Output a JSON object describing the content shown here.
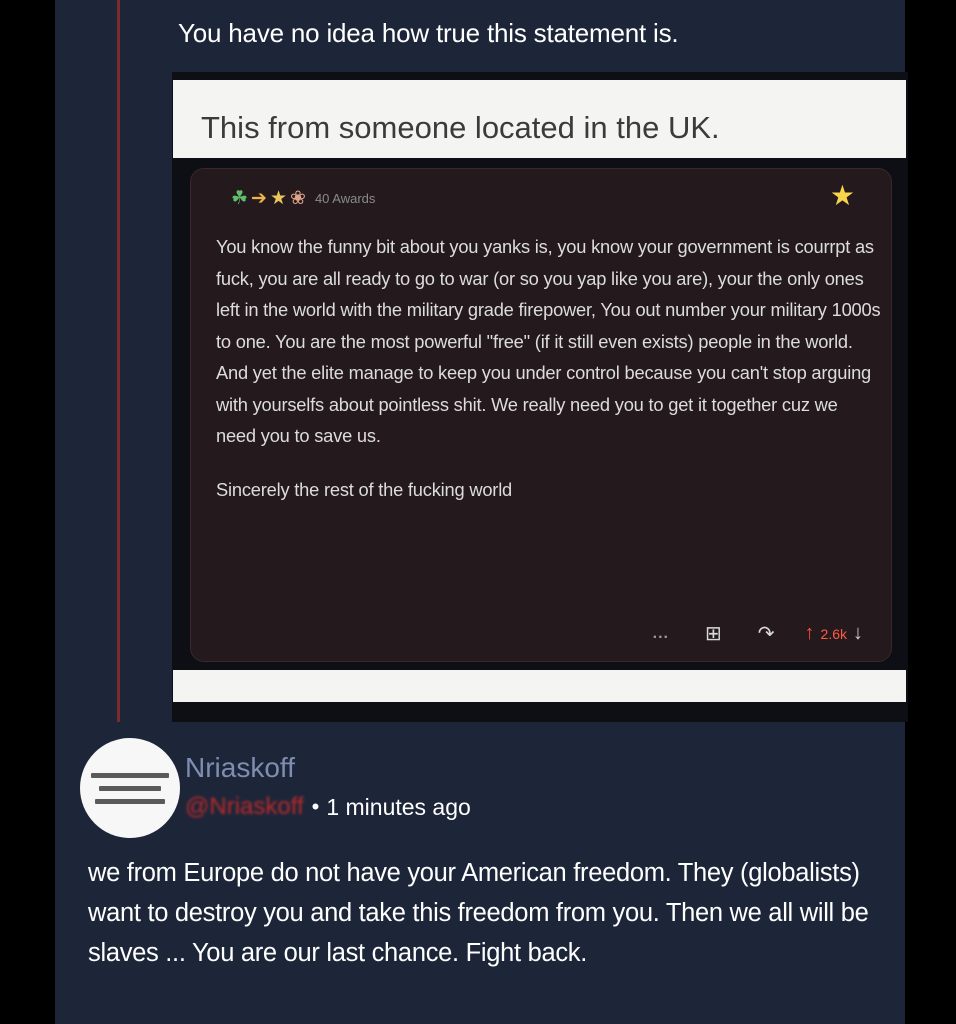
{
  "top_statement": "You have no idea how true this statement is.",
  "embedded": {
    "banner_text": "This from someone located in the UK.",
    "awards_label": "40 Awards",
    "comment_text": "You know the funny bit about you yanks is, you know your government is courrpt as fuck, you are all ready to go to war (or so you yap like you are), your the only ones left in the world with the military grade firepower, You out number your military 1000s to one. You are the most powerful \"free\" (if it still even exists) people in the world. And yet the elite manage to keep you under control because you can't stop arguing with yourselfs about pointless shit. We really need you to get it together cuz we need you to save us.",
    "comment_sign": "Sincerely the rest of the fucking world",
    "actions": {
      "more": "...",
      "score": "2.6k"
    }
  },
  "post": {
    "username": "Nriaskoff",
    "handle": "@Nriaskoff",
    "timestamp": "1 minutes ago",
    "text": "we from Europe do not have your American freedom. They (globalists) want to destroy you and take this freedom from you. Then we all will be slaves ... You are our last chance. Fight back."
  },
  "colors": {
    "background": "#1d2639",
    "username": "#7f8db0",
    "handle": "#b92a2a",
    "upvote": "#ff4a3a"
  },
  "icons": [
    "award-icon",
    "star-award-icon",
    "gift-icon",
    "reply-icon",
    "upvote-icon",
    "downvote-icon",
    "more-icon"
  ]
}
